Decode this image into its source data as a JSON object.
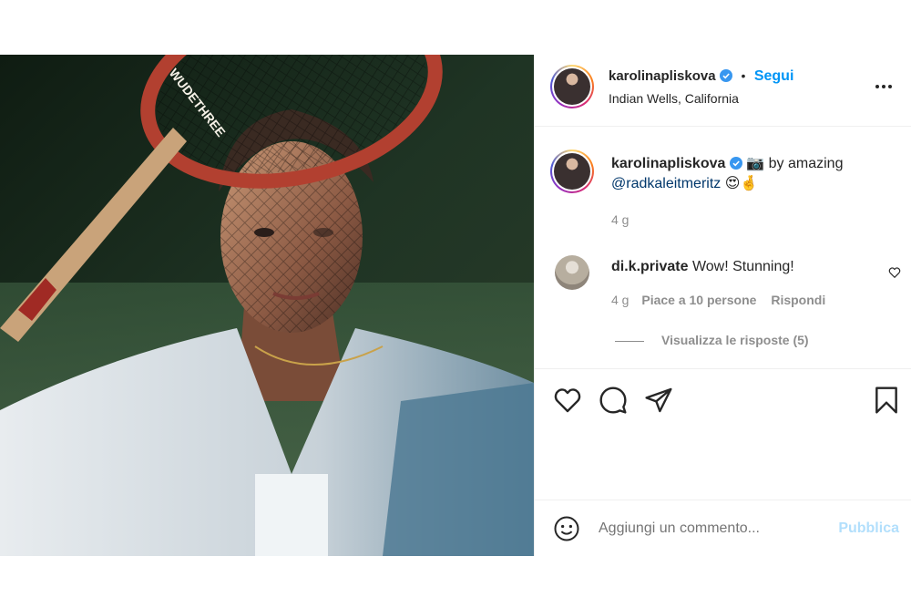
{
  "post": {
    "photo_alt": "Tennis player holding a wooden racket",
    "racket_text": "WUDETHREE"
  },
  "header": {
    "username": "karolinapliskova",
    "separator": "•",
    "follow_label": "Segui",
    "location": "Indian Wells, California"
  },
  "caption": {
    "username": "karolinapliskova",
    "text_before": " 📷 by amazing ",
    "mention": "@radkaleitmeritz",
    "emoji": " 😍🤞",
    "time": "4 g"
  },
  "comment": {
    "username": "di.k.private",
    "text": "Wow! Stunning!",
    "time": "4 g",
    "likes": "Piace a 10 persone",
    "reply_label": "Rispondi",
    "view_replies": "Visualizza le risposte (5)"
  },
  "add_comment": {
    "placeholder": "Aggiungi un commento...",
    "publish_label": "Pubblica"
  },
  "colors": {
    "accent": "#0095f6",
    "mention": "#00376b",
    "muted": "#8e8e8e",
    "publish_disabled": "#b2dffc"
  },
  "icons": [
    "verified-badge-icon",
    "more-options-icon",
    "heart-icon",
    "comment-icon",
    "share-icon",
    "bookmark-icon",
    "emoji-icon",
    "small-heart-icon"
  ]
}
